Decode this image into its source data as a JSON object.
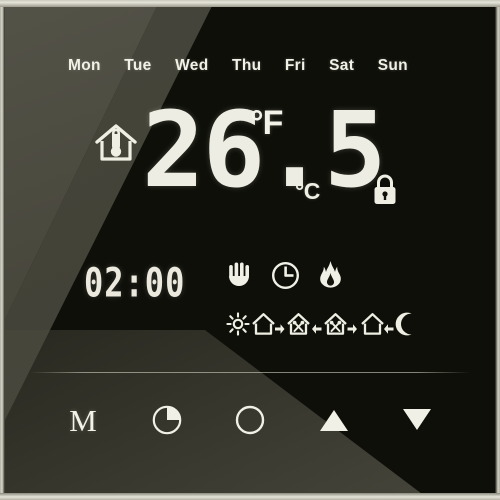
{
  "device": {
    "name": "wifi-touchscreen-thermostat",
    "panel_color": "#0e0f09",
    "gloss_color": "#46453a",
    "lcd_color": "#eeede3"
  },
  "schedule": {
    "days": [
      {
        "label": "Mon",
        "active": true
      },
      {
        "label": "Tue",
        "active": true
      },
      {
        "label": "Wed",
        "active": true
      },
      {
        "label": "Thu",
        "active": true
      },
      {
        "label": "Fri",
        "active": true
      },
      {
        "label": "Sat",
        "active": true
      },
      {
        "label": "Sun",
        "active": true
      }
    ]
  },
  "temperature": {
    "value": "26.5",
    "unit_f_label": "°F",
    "unit_c_label": "°C",
    "room_icon": "house-thermometer-icon",
    "lock_icon": "padlock-icon",
    "locked": true
  },
  "clock": {
    "time": "02:00"
  },
  "status": {
    "icons": [
      {
        "name": "hand-icon",
        "label": "Manual"
      },
      {
        "name": "clock-icon",
        "label": "Program"
      },
      {
        "name": "flame-icon",
        "label": "Heating"
      }
    ]
  },
  "program_strip": {
    "periods": [
      {
        "name": "sun-icon",
        "label": "Wake"
      },
      {
        "name": "house-leave-icon",
        "label": "Leave"
      },
      {
        "name": "meal-return-icon",
        "label": "Return"
      },
      {
        "name": "meal-leave-icon",
        "label": "Leave"
      },
      {
        "name": "house-return-icon",
        "label": "Return"
      },
      {
        "name": "moon-icon",
        "label": "Sleep"
      }
    ]
  },
  "buttons": [
    {
      "name": "menu-button",
      "label": "M",
      "icon": "letter-m"
    },
    {
      "name": "clock-button",
      "label": "",
      "icon": "pie-clock-icon"
    },
    {
      "name": "power-button",
      "label": "",
      "icon": "circle-power-icon"
    },
    {
      "name": "up-button",
      "label": "",
      "icon": "triangle-up-icon"
    },
    {
      "name": "down-button",
      "label": "",
      "icon": "triangle-down-icon"
    }
  ]
}
